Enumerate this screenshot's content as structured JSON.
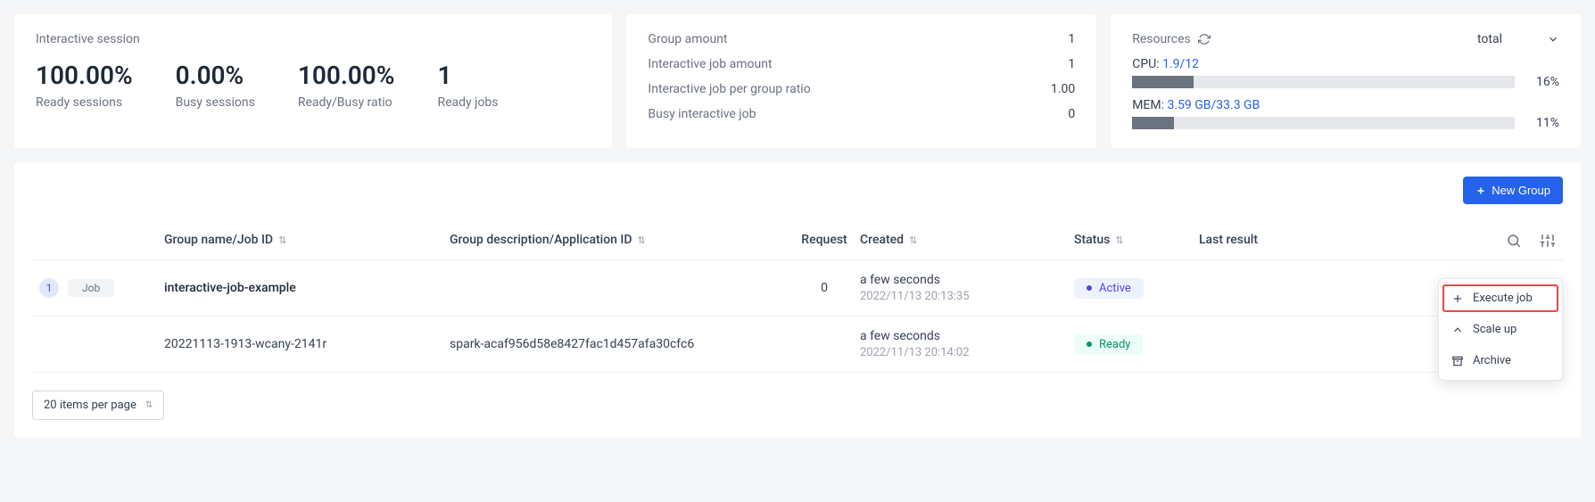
{
  "session_card": {
    "title": "Interactive session",
    "stats": [
      {
        "value": "100.00%",
        "label": "Ready sessions"
      },
      {
        "value": "0.00%",
        "label": "Busy sessions"
      },
      {
        "value": "100.00%",
        "label": "Ready/Busy ratio"
      },
      {
        "value": "1",
        "label": "Ready jobs"
      }
    ]
  },
  "group_card": {
    "rows": [
      {
        "key": "Group amount",
        "val": "1"
      },
      {
        "key": "Interactive job amount",
        "val": "1"
      },
      {
        "key": "Interactive job per group ratio",
        "val": "1.00"
      },
      {
        "key": "Busy interactive job",
        "val": "0"
      }
    ]
  },
  "resources_card": {
    "title": "Resources",
    "scope": "total",
    "cpu_label": "CPU:",
    "cpu_val": "1.9/12",
    "cpu_pct": "16%",
    "cpu_fill": 16,
    "mem_label": "MEM:",
    "mem_val": "3.59 GB/33.3 GB",
    "mem_pct": "11%",
    "mem_fill": 11
  },
  "toolbar": {
    "new_group": "New Group"
  },
  "table": {
    "headers": {
      "name": "Group name/Job ID",
      "desc": "Group description/Application ID",
      "request": "Request",
      "created": "Created",
      "status": "Status",
      "result": "Last result"
    },
    "rows": [
      {
        "badge_num": "1",
        "badge_type": "Job",
        "name": "interactive-job-example",
        "desc": "",
        "request": "0",
        "created_rel": "a few seconds",
        "created_abs": "2022/11/13 20:13:35",
        "status_text": "Active",
        "status_class": "active"
      },
      {
        "badge_num": "",
        "badge_type": "",
        "name": "20221113-1913-wcany-2141r",
        "desc": "spark-acaf956d58e8427fac1d457afa30cfc6",
        "request": "",
        "created_rel": "a few seconds",
        "created_abs": "2022/11/13 20:14:02",
        "status_text": "Ready",
        "status_class": "ready"
      }
    ]
  },
  "dropdown": {
    "execute": "Execute job",
    "scaleup": "Scale up",
    "archive": "Archive"
  },
  "pager": {
    "label": "20 items per page"
  }
}
